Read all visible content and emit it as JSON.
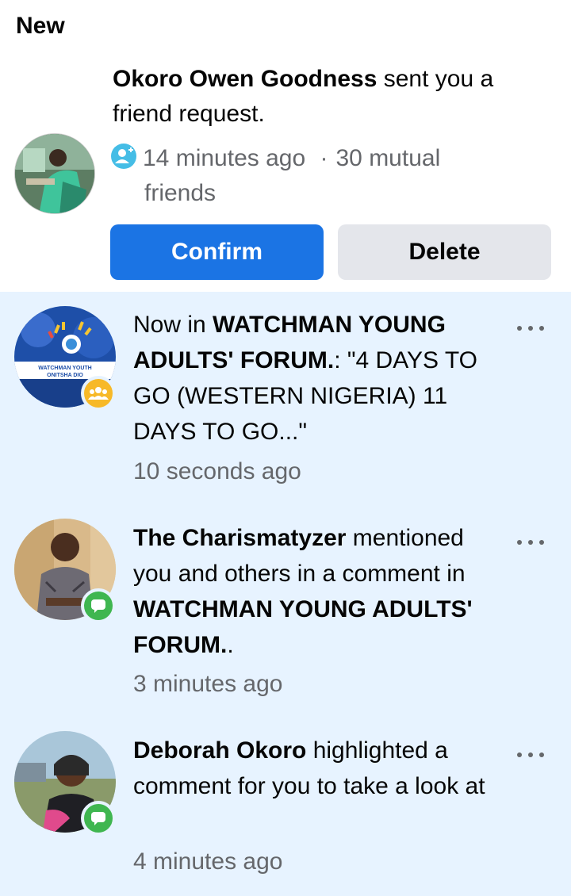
{
  "section_title": "New",
  "friend_request": {
    "name": "Okoro Owen Goodness",
    "action": " sent you a friend request.",
    "time": "14 minutes ago",
    "separator": "·",
    "mutual_line1": "30 mutual",
    "mutual_line2": "friends",
    "confirm_label": "Confirm",
    "delete_label": "Delete",
    "confirm_color": "#1b74e4",
    "delete_color": "#e4e6eb"
  },
  "notifications": [
    {
      "prefix": "Now in ",
      "bold": "WATCHMAN YOUNG ADULTS' FORUM.",
      "suffix": ": \"4 DAYS TO GO (WESTERN NIGERIA) 11 DAYS TO GO...\"",
      "time": "10 seconds ago",
      "badge": "group-icon",
      "avatar_text_1": "WATCHMAN YOUTH",
      "avatar_text_2": "ONITSHA DIO"
    },
    {
      "bold": "The Charismatyzer",
      "mid": " mentioned you and others in a comment in ",
      "bold2": "WATCHMAN YOUNG ADULTS' FORUM.",
      "suffix": ".",
      "time": "3 minutes ago",
      "badge": "comment-icon"
    },
    {
      "bold": "Deborah Okoro",
      "mid": " highlighted a comment for you to take a look at",
      "time": "4 minutes ago",
      "badge": "comment-icon"
    }
  ],
  "colors": {
    "unread_bg": "#e7f3ff",
    "group_badge": "#f7b928",
    "comment_badge": "#3fb650",
    "meta_icon": "#45bde6"
  }
}
